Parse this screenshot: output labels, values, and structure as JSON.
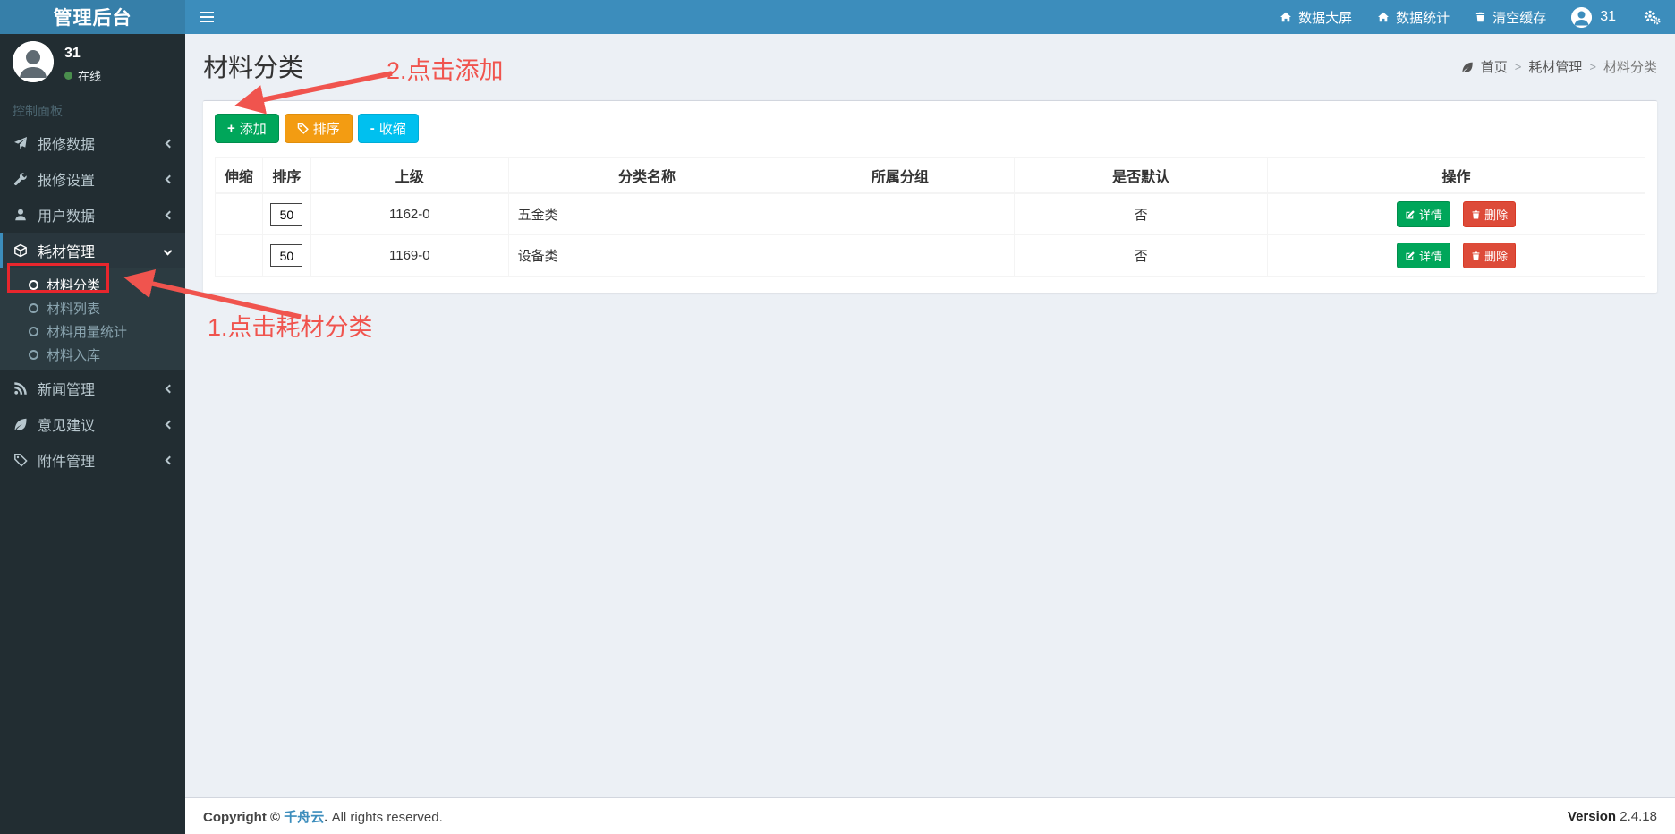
{
  "header": {
    "title": "管理后台",
    "nav_items": [
      {
        "label": "数据大屏",
        "icon": "home-icon"
      },
      {
        "label": "数据统计",
        "icon": "home-icon"
      },
      {
        "label": "清空缓存",
        "icon": "trash-icon"
      }
    ],
    "username": "31"
  },
  "sidebar": {
    "user_name": "31",
    "user_status": "在线",
    "section_label": "控制面板",
    "items": [
      {
        "label": "报修数据",
        "icon": "send-icon"
      },
      {
        "label": "报修设置",
        "icon": "wrench-icon"
      },
      {
        "label": "用户数据",
        "icon": "user-icon"
      },
      {
        "label": "耗材管理",
        "icon": "cube-icon",
        "children": [
          "材料分类",
          "材料列表",
          "材料用量统计",
          "材料入库"
        ]
      },
      {
        "label": "新闻管理",
        "icon": "rss-icon"
      },
      {
        "label": "意见建议",
        "icon": "leaf-icon"
      },
      {
        "label": "附件管理",
        "icon": "tag-icon"
      }
    ]
  },
  "content": {
    "page_title": "材料分类",
    "breadcrumb": [
      "首页",
      "耗材管理",
      "材料分类"
    ],
    "toolbar": {
      "add": "添加",
      "add_glyph": "+",
      "sort": "排序",
      "collapse": "收缩",
      "collapse_glyph": "-"
    },
    "table": {
      "columns": [
        "伸缩",
        "排序",
        "上级",
        "分类名称",
        "所属分组",
        "是否默认",
        "操作"
      ],
      "rows": [
        {
          "stretch": "",
          "sort": "50",
          "parent": "1162-0",
          "name": "五金类",
          "group": "",
          "is_default": "否"
        },
        {
          "stretch": "",
          "sort": "50",
          "parent": "1169-0",
          "name": "设备类",
          "group": "",
          "is_default": "否"
        }
      ],
      "action_labels": {
        "detail": "详情",
        "remove": "删除"
      }
    },
    "annotations": {
      "step1": "1.点击耗材分类",
      "step2": "2.点击添加"
    }
  },
  "footer": {
    "copyright_prefix": "Copyright © ",
    "brand": "千舟云",
    "copyright_dot": ".",
    "rights": " All rights reserved.",
    "version_label": "Version",
    "version_value": "2.4.18"
  },
  "colors": {
    "navbar_blue": "#3c8dbc",
    "logo_blue": "#367fa9",
    "sidebar_dark": "#222d32",
    "submenu_dark": "#2c3b41",
    "green": "#00a65a",
    "orange": "#f39c12",
    "cyan": "#00c0ef",
    "red": "#dd4b39",
    "annotation_red": "#f0544e",
    "highlight_box_red": "#e8262d",
    "online_dot_green": "#4a8e4d"
  }
}
